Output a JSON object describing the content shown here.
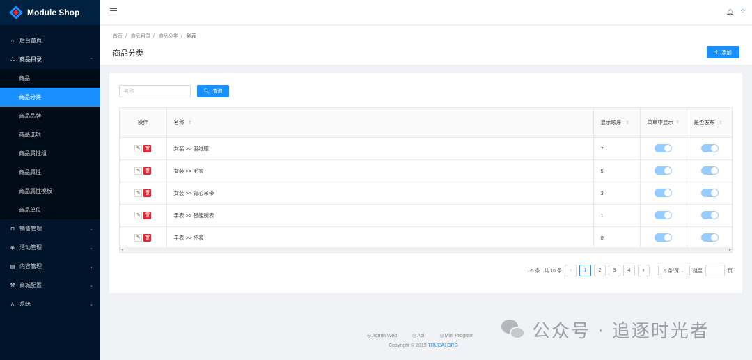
{
  "app": {
    "title": "Module Shop"
  },
  "sidebar": {
    "items": [
      {
        "label": "后台首页",
        "icon": "home-icon"
      },
      {
        "label": "商品目录",
        "icon": "cluster-icon",
        "open": true,
        "children": [
          "商品",
          "商品分类",
          "商品品牌",
          "商品选项",
          "商品属性组",
          "商品属性",
          "商品属性模板",
          "商品单位"
        ],
        "active_child": "商品分类"
      },
      {
        "label": "销售管理",
        "icon": "bag-icon"
      },
      {
        "label": "活动管理",
        "icon": "tag-icon"
      },
      {
        "label": "内容管理",
        "icon": "file-icon"
      },
      {
        "label": "商城配置",
        "icon": "tool-icon"
      },
      {
        "label": "系统",
        "icon": "team-icon"
      }
    ]
  },
  "breadcrumb": [
    "首页",
    "商品目录",
    "商品分类",
    "列表"
  ],
  "page_title": "商品分类",
  "add_button": "添加",
  "search": {
    "placeholder": "名称",
    "value": "",
    "button": "查询"
  },
  "table": {
    "columns": [
      "操作",
      "名称",
      "显示顺序",
      "菜单中显示",
      "是否发布"
    ],
    "rows": [
      {
        "name": "女装 >> 羽绒服",
        "order": "7",
        "show_in_menu": true,
        "published": true
      },
      {
        "name": "女装 >> 毛衣",
        "order": "5",
        "show_in_menu": true,
        "published": true
      },
      {
        "name": "女装 >> 背心吊带",
        "order": "3",
        "show_in_menu": true,
        "published": true
      },
      {
        "name": "手表 >> 智能腕表",
        "order": "1",
        "show_in_menu": true,
        "published": true
      },
      {
        "name": "手表 >> 怀表",
        "order": "0",
        "show_in_menu": true,
        "published": true
      }
    ]
  },
  "pagination": {
    "summary": "1-5 条 , 共 16 条",
    "pages": [
      "1",
      "2",
      "3",
      "4"
    ],
    "current": "1",
    "page_size": "5 条/页",
    "jump_label": "跳至",
    "page_suffix": "页"
  },
  "footer": {
    "links": [
      "Admin Web",
      "Api",
      "Mini Program"
    ],
    "copyright_prefix": "Copyright",
    "copyright_year": "2019",
    "copyright_brand": "TRUEAI.ORG"
  },
  "watermark": {
    "text": "公众号 · 追逐时光者"
  },
  "colors": {
    "primary": "#1890ff",
    "danger": "#f5222d",
    "sidebar_bg": "#001529"
  }
}
